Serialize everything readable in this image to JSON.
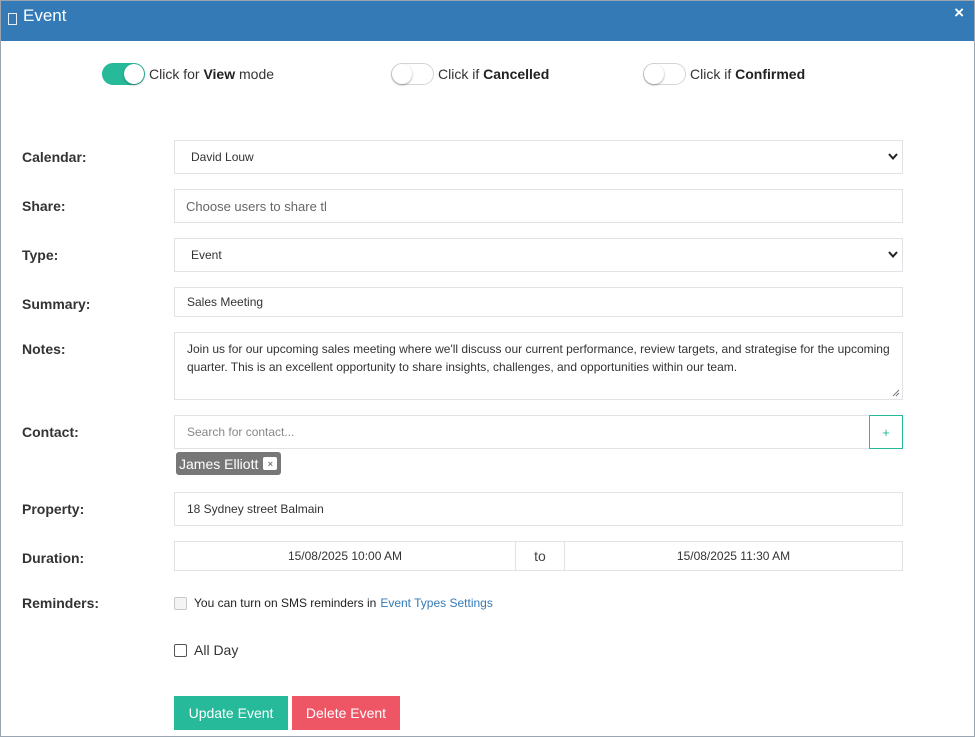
{
  "window": {
    "title": "Event",
    "close_label": "×"
  },
  "toggles": [
    {
      "prefix": "Click for ",
      "bold": "View",
      "suffix": " mode",
      "on": true
    },
    {
      "prefix": "Click if ",
      "bold": "Cancelled",
      "suffix": "",
      "on": false
    },
    {
      "prefix": "Click if ",
      "bold": "Confirmed",
      "suffix": "",
      "on": false
    }
  ],
  "form": {
    "calendar": {
      "label": "Calendar:",
      "value": "David Louw"
    },
    "share": {
      "label": "Share:",
      "placeholder": "Choose users to share tl"
    },
    "type": {
      "label": "Type:",
      "value": "Event"
    },
    "summary": {
      "label": "Summary:",
      "value": "Sales Meeting"
    },
    "notes": {
      "label": "Notes:",
      "value": "Join us for our upcoming sales meeting where we'll discuss our current performance, review targets, and strategise for the upcoming quarter. This is an excellent opportunity to share insights, challenges, and opportunities within our team."
    },
    "contact": {
      "label": "Contact:",
      "placeholder": "Search for contact...",
      "add_label": "+",
      "selected": [
        {
          "name": "James Elliott",
          "remove_label": "×"
        }
      ]
    },
    "property": {
      "label": "Property:",
      "value": "18 Sydney street Balmain"
    },
    "duration": {
      "label": "Duration:",
      "start": "15/08/2025 10:00 AM",
      "separator": "to",
      "end": "15/08/2025 11:30 AM"
    },
    "reminders": {
      "label": "Reminders:",
      "text": "You can turn on SMS reminders in",
      "link": "Event Types Settings"
    },
    "all_day": {
      "label": "All Day",
      "checked": false
    }
  },
  "buttons": {
    "update": "Update Event",
    "delete": "Delete Event"
  },
  "colors": {
    "header": "#337ab7",
    "accent": "#26b99a",
    "danger": "#ef5665",
    "chip": "#777777",
    "link": "#337ab7"
  }
}
